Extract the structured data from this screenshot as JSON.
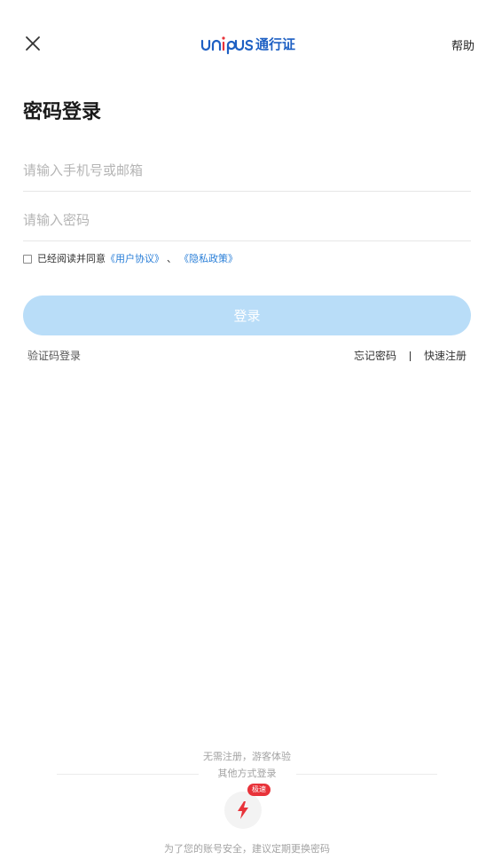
{
  "header": {
    "brand_text": "通行证",
    "help_label": "帮助",
    "brand_color": "#1d5fc3"
  },
  "icons": {
    "close": "close-icon",
    "logo": "unipus-logo",
    "quick_login": "lightning-icon"
  },
  "page": {
    "title": "密码登录"
  },
  "form": {
    "phone_placeholder": "请输入手机号或邮箱",
    "phone_value": "",
    "password_placeholder": "请输入密码",
    "password_value": "",
    "agreement_checked": false,
    "agreement_prefix": "已经阅读并同意",
    "user_agreement_label": "《用户协议》",
    "agreement_separator": "、",
    "privacy_policy_label": "《隐私政策》",
    "login_label": "登录",
    "login_button_color": "#b9ddf8",
    "link_color": "#2a7fd8"
  },
  "links": {
    "sms_login": "验证码登录",
    "forgot_password": "忘记密码",
    "quick_register": "快速注册"
  },
  "bottom": {
    "guest_label": "无需注册，游客体验",
    "other_methods_label": "其他方式登录",
    "quick_badge": "极速",
    "security_tip": "为了您的账号安全，建议定期更换密码"
  }
}
